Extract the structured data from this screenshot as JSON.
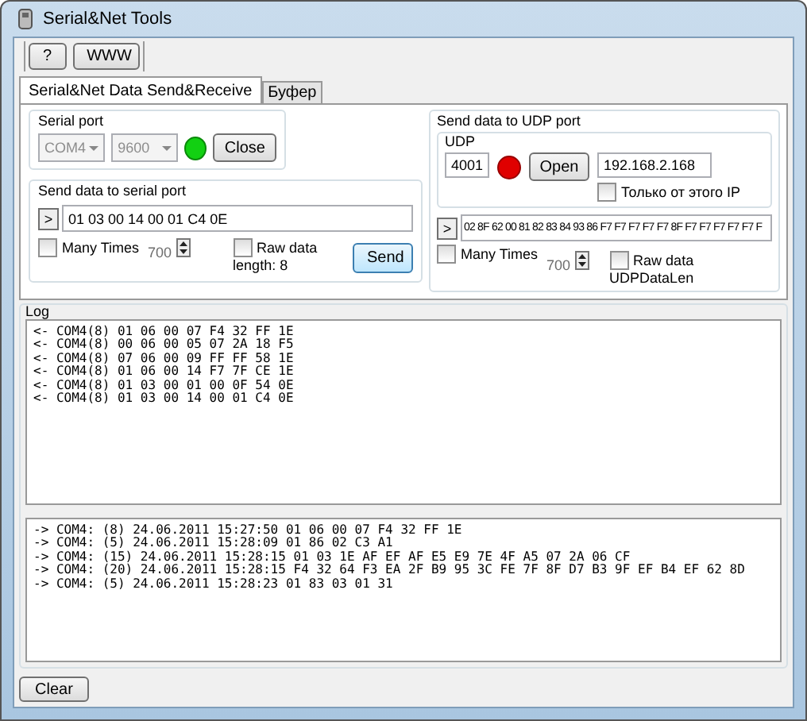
{
  "window": {
    "title": "Serial&Net Tools"
  },
  "toolbar": [
    "?",
    "WWW"
  ],
  "tabs": [
    {
      "label": "Serial&Net Data Send&Receive",
      "selected": true
    },
    {
      "label": "Буфер",
      "selected": false
    }
  ],
  "serial_port": {
    "title": "Serial port",
    "port": {
      "value": "COM4",
      "disabled": true
    },
    "baud": {
      "value": "9600",
      "disabled": true
    },
    "open": true,
    "button": "Close"
  },
  "send_serial": {
    "title": "Send data  to serial port",
    "prefix": ">",
    "value": "01 03 00 14 00 01 C4 0E",
    "many_times": {
      "label": "Many Times",
      "checked": false
    },
    "count": {
      "value": "700",
      "disabled": true
    },
    "raw_data": {
      "label": "Raw data",
      "checked": false
    },
    "length": "length: 8",
    "button": "Send"
  },
  "udp": {
    "title": "Send data  to UDP port",
    "group": "UDP",
    "port": "4001",
    "open": false,
    "button": "Open",
    "ip": "192.168.2.168",
    "only_this_ip": {
      "label": "Только от этого IP",
      "checked": false
    },
    "prefix": ">",
    "value": "02 8F 62 00 81 82 83 84 93 86 F7 F7 F7 F7 F7 8F F7 F7 F7 F7 F7 F",
    "many_times": {
      "label": "Many Times",
      "checked": false
    },
    "count": {
      "value": "700",
      "disabled": true
    },
    "raw_data": {
      "label": "Raw data",
      "checked": false
    },
    "length": "UDPDataLen"
  },
  "log": {
    "title": "Log",
    "received": [
      "<- COM4(8) 01 06 00 07 F4 32 FF 1E",
      "<- COM4(8) 00 06 00 05 07 2A 18 F5",
      "<- COM4(8) 07 06 00 09 FF FF 58 1E",
      "<- COM4(8) 01 06 00 14 F7 7F CE 1E",
      "<- COM4(8) 01 03 00 01 00 0F 54 0E",
      "<- COM4(8) 01 03 00 14 00 01 C4 0E"
    ],
    "sent": [
      "-> COM4: (8) 24.06.2011 15:27:50 01 06 00 07 F4 32 FF 1E",
      "-> COM4: (5) 24.06.2011 15:28:09 01 86 02 C3 A1",
      "-> COM4: (15) 24.06.2011 15:28:15 01 03 1E AF EF AF E5 E9 7E 4F A5 07 2A 06 CF",
      "-> COM4: (20) 24.06.2011 15:28:15 F4 32 64 F3 EA 2F B9 95 3C FE 7F 8F D7 B3 9F EF B4 EF 62 8D",
      "-> COM4: (5) 24.06.2011 15:28:23 01 83 03 01 31"
    ]
  },
  "clear_button": "Clear"
}
